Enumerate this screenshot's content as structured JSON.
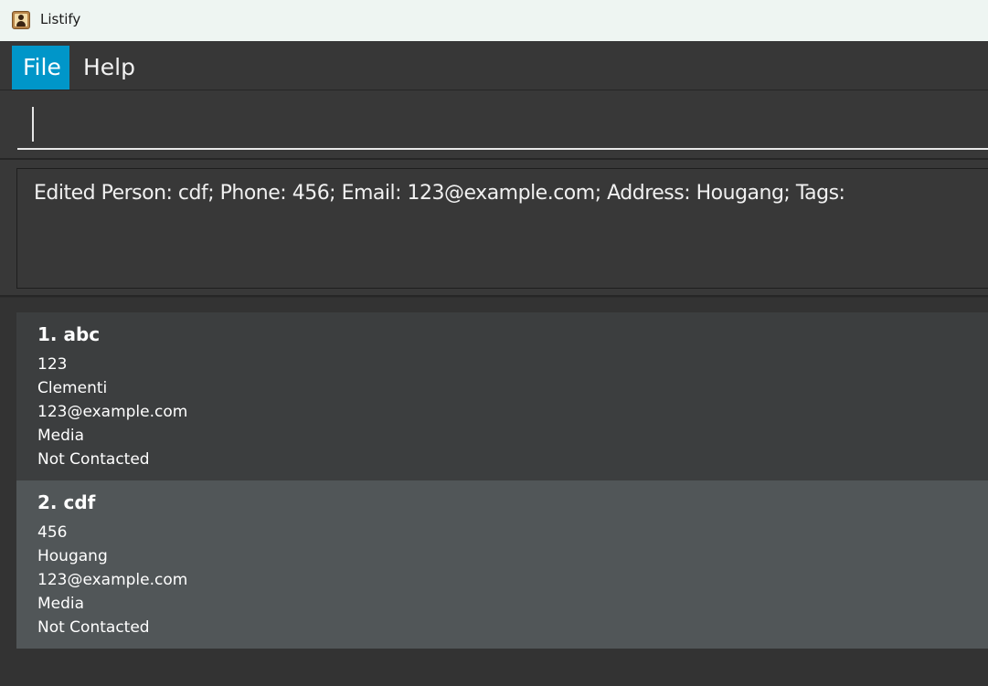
{
  "window": {
    "title": "Listify",
    "icon": "address-book-icon"
  },
  "menu": {
    "items": [
      {
        "label": "File",
        "active": true
      },
      {
        "label": "Help",
        "active": false
      }
    ]
  },
  "command_box": {
    "value": "",
    "placeholder": ""
  },
  "result_display": {
    "text": "Edited Person: cdf; Phone: 456; Email: 123@example.com; Address: Hougang; Tags:"
  },
  "persons": [
    {
      "index_name": "1. abc",
      "phone": "123",
      "address": "Clementi",
      "email": "123@example.com",
      "category": "Media",
      "status": "Not Contacted"
    },
    {
      "index_name": "2. cdf",
      "phone": "456",
      "address": "Hougang",
      "email": "123@example.com",
      "category": "Media",
      "status": "Not Contacted"
    }
  ],
  "colors": {
    "accent": "#0096c9",
    "background": "#2e2e2e",
    "card_odd": "#3c3e3f",
    "card_selected": "#515658",
    "titlebar": "#eef5f2"
  }
}
